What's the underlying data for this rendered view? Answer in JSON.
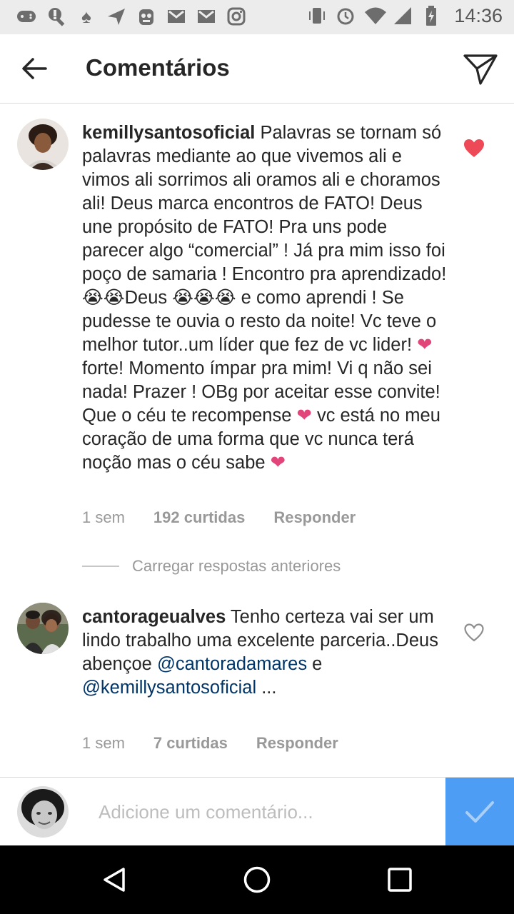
{
  "status_bar": {
    "left_icons": [
      "gamepad-icon",
      "search-icon",
      "spade-icon",
      "send-icon",
      "character-icon",
      "gmail-icon",
      "gmail-icon",
      "instagram-icon"
    ],
    "right_icons": [
      "vibrate-icon",
      "alarm-icon",
      "wifi-icon",
      "signal-icon",
      "battery-icon"
    ],
    "time": "14:36"
  },
  "header": {
    "title": "Comentários",
    "back_icon": "arrow-left-icon",
    "send_icon": "direct-send-icon"
  },
  "comments": [
    {
      "username": "kemillysantosoficial",
      "text_parts": [
        " Palavras se tornam só palavras mediante ao que vivemos ali e vimos ali sorrimos ali oramos ali e choramos ali! Deus marca encontros de FATO! Deus une propósito de FATO! Pra uns pode parecer algo “comercial” ! Já pra mim isso foi poço de samaria ! Encontro pra aprendizado! 😭😭Deus 😭😭😭 e como aprendi ! Se pudesse te ouvia o resto da noite! Vc teve o melhor tutor..um líder que fez de vc lider! ",
        "❤",
        " forte! Momento ímpar pra mim! Vi q não sei nada! Prazer ! OBg por aceitar esse convite! Que o céu te recompense ",
        "❤",
        " vc está no meu coração de uma forma que vc nunca terá noção mas o céu sabe ",
        "❤"
      ],
      "time": "1 sem",
      "likes": "192 curtidas",
      "reply": "Responder",
      "liked": true,
      "like_color": "#ed4956"
    },
    {
      "username": "cantorageualves",
      "text_parts": [
        " Tenho certeza vai ser um lindo trabalho uma excelente parceria..Deus abençoe ",
        "@cantoradamares",
        " e ",
        "@kemillysantosoficial",
        " ..."
      ],
      "time": "1 sem",
      "likes": "7 curtidas",
      "reply": "Responder",
      "liked": false
    }
  ],
  "load_previous": "Carregar respostas anteriores",
  "comment_input": {
    "placeholder": "Adicione um comentário...",
    "value": "",
    "post_icon": "checkmark-icon",
    "post_color": "#4d9df4"
  },
  "nav_bar": {
    "buttons": [
      "back-triangle-icon",
      "home-circle-icon",
      "recents-square-icon"
    ]
  }
}
